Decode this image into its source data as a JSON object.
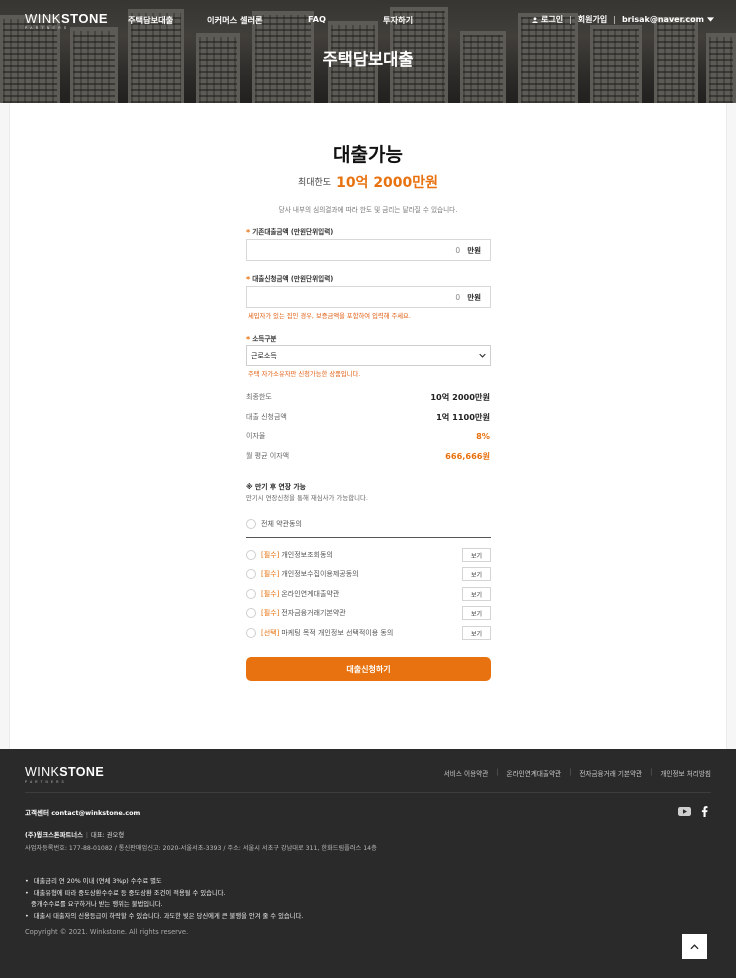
{
  "header": {
    "logo_light": "WINK",
    "logo_bold": "STONE",
    "logo_sub": "PARTNERS",
    "nav": [
      "주택담보대출",
      "이커머스 셀러론",
      "FAQ",
      "투자하기"
    ],
    "login": "로그인",
    "signup": "회원가입",
    "user_email": "brisak@naver.com",
    "hero_title": "주택담보대출"
  },
  "loan": {
    "status_title": "대출가능",
    "max_label": "최대한도",
    "max_amount": "10억 2000만원",
    "subtitle": "당사 내부의 심의결과에 따라 한도 및 금리는 달라질 수 있습니다.",
    "existing_label": "기존대출금액 (만원단위입력)",
    "existing_value": "0",
    "request_label": "대출신청금액 (만원단위입력)",
    "request_value": "0",
    "unit": "만원",
    "request_note": "세입자가 있는 집인 경우, 보증금액을 포함하여 입력해 주세요.",
    "income_label": "소득구분",
    "income_selected": "근로소득",
    "income_note": "주택 자가소유자만 신청가능한 상품입니다.",
    "summary": [
      {
        "label": "최종한도",
        "value": "10억 2000만원"
      },
      {
        "label": "대출 신청금액",
        "value": "1억 1100만원"
      },
      {
        "label": "이자율",
        "value": "8%"
      },
      {
        "label": "월 평균 이자액",
        "value": "666,666원"
      }
    ],
    "extension_title": "※ 만기 후 연장 가능",
    "extension_desc": "만기시 연장신청을 통해 재심사가 가능합니다.",
    "agree_all": "전체 약관동의",
    "agreements": [
      {
        "tag": "[필수]",
        "text": "개인정보조회동의",
        "button": "보기"
      },
      {
        "tag": "[필수]",
        "text": "개인정보수집이용제공동의",
        "button": "보기"
      },
      {
        "tag": "[필수]",
        "text": "온라인연계대출약관",
        "button": "보기"
      },
      {
        "tag": "[필수]",
        "text": "전자금융거래기본약관",
        "button": "보기"
      },
      {
        "tag": "[선택]",
        "text": "마케팅 목적 개인정보 선택적이용 동의",
        "button": "보기"
      }
    ],
    "submit": "대출신청하기"
  },
  "footer": {
    "links": [
      "서비스 이용약관",
      "온라인연계대출약관",
      "전자금융거래 기본약관",
      "개인정보 처리방침"
    ],
    "cs_label": "고객센터",
    "cs_email": "contact@winkstone.com",
    "company": "(주)윙크스톤파트너스",
    "ceo": "대표: 권오형",
    "reg": "사업자등록번호: 177-88-01082 / 통신판매업신고: 2020-서울서초-3393 / 주소: 서울시 서초구 강남대로 311, 한화드림플러스 14층",
    "disclaimers": [
      "대출금리 연 20% 이내 (연체 3%p) 수수료 별도",
      "대출유형에 따라 중도상환수수료 등 중도상환 조건이 적용될 수 있습니다.",
      "중개수수료를 요구하거나 받는 행위는 불법입니다.",
      "대출시 대출자의 신용등급이 하락할 수 있습니다. 과도한 빚은 당신에게 큰 불행을 안겨 줄 수 있습니다."
    ],
    "copyright": "Copyright © 2021. Winkstone. All rights reserve."
  },
  "colors": {
    "accent": "#e8720f",
    "footer_bg": "#2a2a2a",
    "hero_bg": "#4c4a45"
  },
  "icons": {
    "user": "user-icon",
    "caret": "caret-down-icon",
    "youtube": "youtube-icon",
    "facebook": "facebook-icon",
    "totop": "chevron-up-icon"
  }
}
